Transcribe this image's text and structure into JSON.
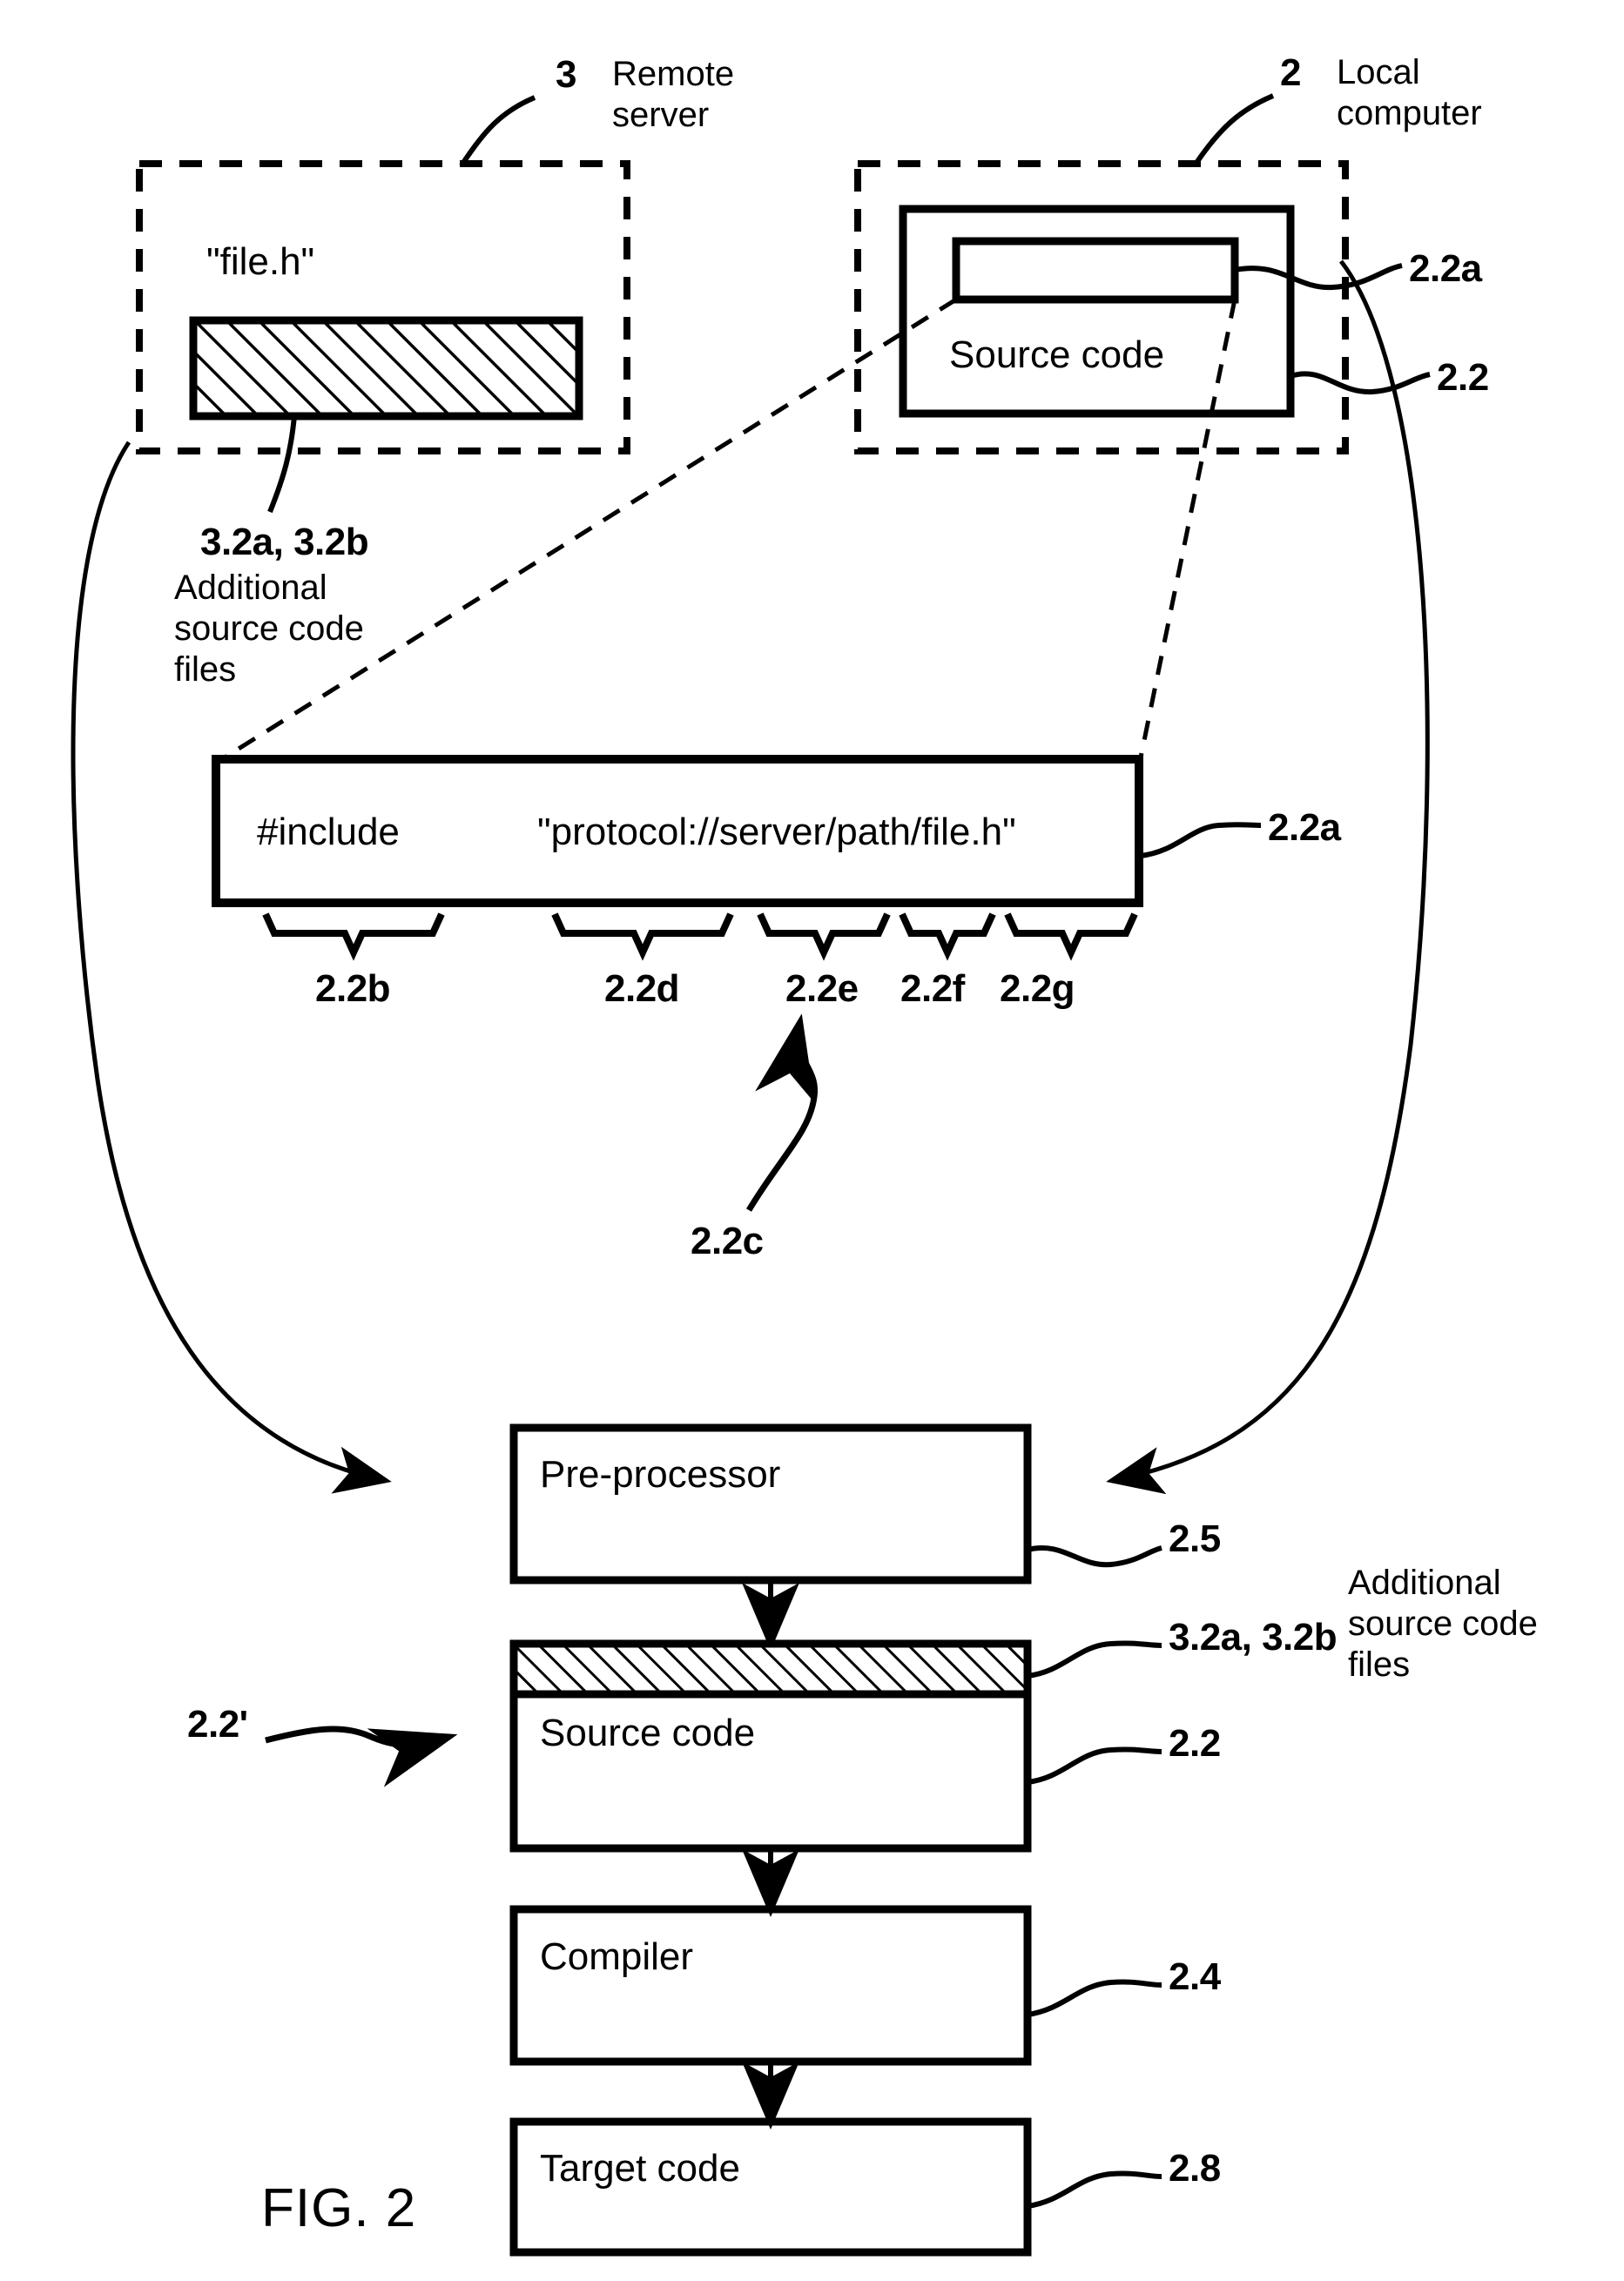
{
  "figure": {
    "caption": "FIG. 2"
  },
  "remote_server": {
    "ref": "3",
    "title": "Remote\nserver",
    "file_label": "\"file.h\"",
    "hatched_ref": "3.2a, 3.2b",
    "hatched_desc": "Additional\nsource code\nfiles"
  },
  "local_computer": {
    "ref": "2",
    "title": "Local\ncomputer",
    "source_code_label": "Source code",
    "inner_ref": "2.2a",
    "outer_ref": "2.2"
  },
  "include_statement": {
    "directive": "#include",
    "path": "\"protocol://server/path/file.h\"",
    "ref": "2.2a",
    "brace_labels": [
      "2.2b",
      "2.2d",
      "2.2e",
      "2.2f",
      "2.2g"
    ],
    "arrow_ref": "2.2c"
  },
  "pipeline": {
    "preprocessor": {
      "label": "Pre-processor",
      "ref": "2.5"
    },
    "source_code_out": {
      "label": "Source code",
      "ref": "2.2",
      "hatched_ref": "3.2a, 3.2b",
      "hatched_desc": "Additional\nsource code\nfiles",
      "prime_ref": "2.2'"
    },
    "compiler": {
      "label": "Compiler",
      "ref": "2.4"
    },
    "target_code": {
      "label": "Target code",
      "ref": "2.8"
    }
  },
  "colors": {
    "ink": "#000000",
    "paper": "#ffffff"
  }
}
